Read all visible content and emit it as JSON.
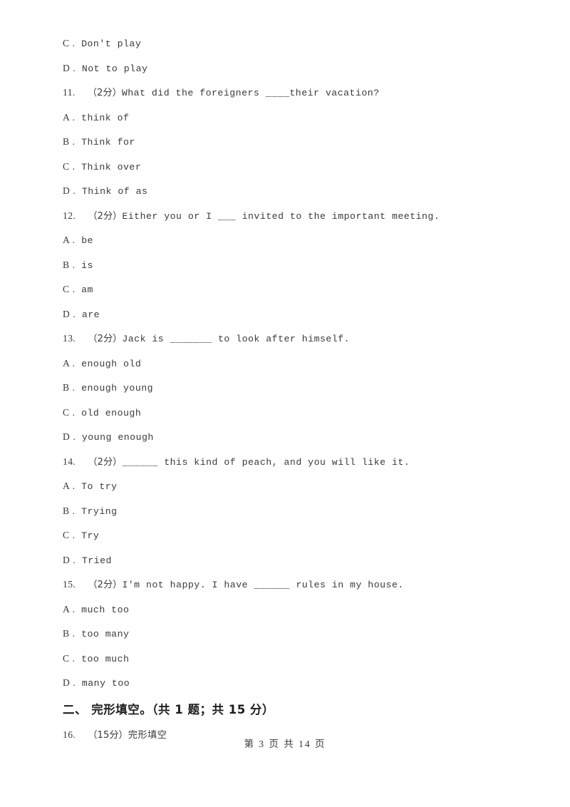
{
  "document": {
    "type": "exam-paper",
    "page_footer": "第 3 页 共 14 页"
  },
  "blocks": [
    {
      "kind": "option",
      "label": "C .",
      "text": "Don't play"
    },
    {
      "kind": "option",
      "label": "D .",
      "text": "Not to play"
    },
    {
      "kind": "question",
      "number": "11.",
      "marks": "（2分）",
      "text": "What did the foreigners ____their vacation?"
    },
    {
      "kind": "option",
      "label": "A .",
      "text": "think of"
    },
    {
      "kind": "option",
      "label": "B .",
      "text": "Think for"
    },
    {
      "kind": "option",
      "label": "C .",
      "text": "Think over"
    },
    {
      "kind": "option",
      "label": "D .",
      "text": "Think of as"
    },
    {
      "kind": "question",
      "number": "12.",
      "marks": "（2分）",
      "text": "Either you or I ___ invited to the important meeting."
    },
    {
      "kind": "option",
      "label": "A .",
      "text": "be"
    },
    {
      "kind": "option",
      "label": "B .",
      "text": "is"
    },
    {
      "kind": "option",
      "label": "C .",
      "text": "am"
    },
    {
      "kind": "option",
      "label": "D .",
      "text": "are"
    },
    {
      "kind": "question",
      "number": "13.",
      "marks": "（2分）",
      "text": "Jack is _______ to look after himself."
    },
    {
      "kind": "option",
      "label": "A .",
      "text": "enough old"
    },
    {
      "kind": "option",
      "label": "B .",
      "text": "enough young"
    },
    {
      "kind": "option",
      "label": "C .",
      "text": "old enough"
    },
    {
      "kind": "option",
      "label": "D .",
      "text": "young enough"
    },
    {
      "kind": "question",
      "number": "14.",
      "marks": "（2分）",
      "text": "______ this kind of peach, and you will like it."
    },
    {
      "kind": "option",
      "label": "A .",
      "text": "To try"
    },
    {
      "kind": "option",
      "label": "B .",
      "text": "Trying"
    },
    {
      "kind": "option",
      "label": "C .",
      "text": "Try"
    },
    {
      "kind": "option",
      "label": "D .",
      "text": "Tried"
    },
    {
      "kind": "question",
      "number": "15.",
      "marks": "（2分）",
      "text": "I'm not happy. I have ______ rules in my house."
    },
    {
      "kind": "option",
      "label": "A .",
      "text": "much too"
    },
    {
      "kind": "option",
      "label": "B .",
      "text": "too many"
    },
    {
      "kind": "option",
      "label": "C .",
      "text": "too much"
    },
    {
      "kind": "option",
      "label": "D .",
      "text": "many too"
    },
    {
      "kind": "heading",
      "text": "二、 完形填空。（共 1 题；共 15 分）"
    },
    {
      "kind": "question",
      "number": "16.",
      "marks": "（15分）",
      "text": "完形填空",
      "cjk_body": true
    }
  ]
}
